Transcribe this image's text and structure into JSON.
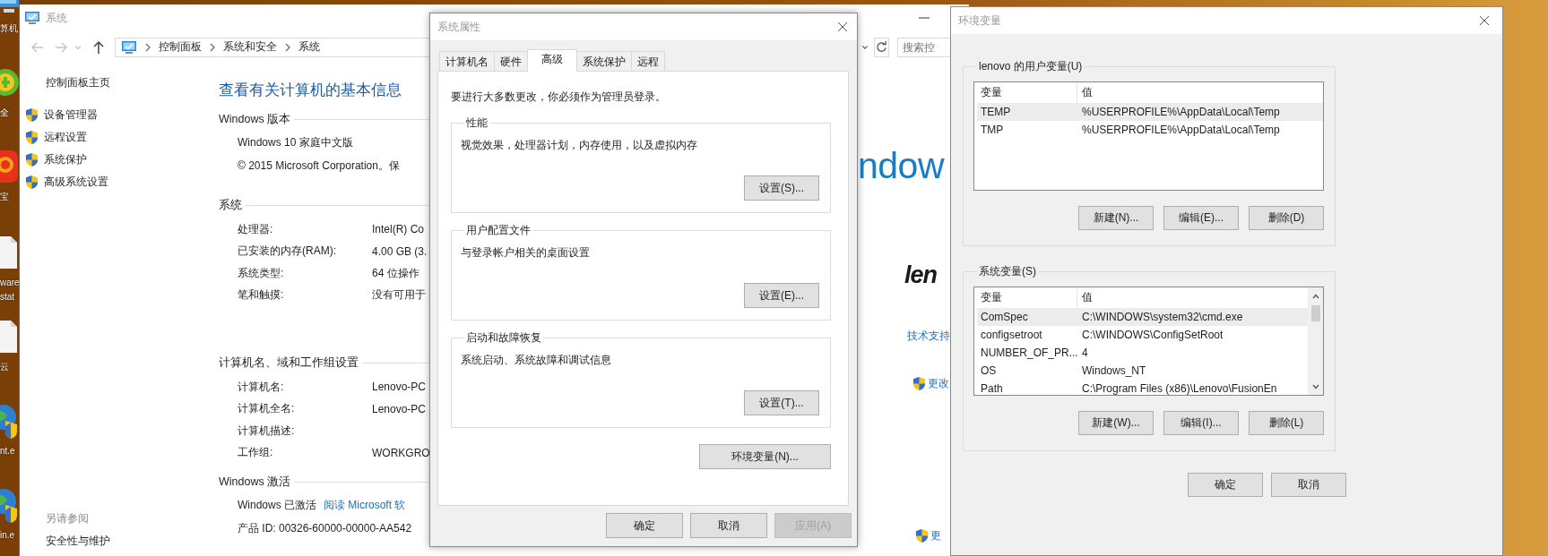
{
  "desktop": {
    "icons": [
      {
        "kind": "monitor",
        "lines": [
          "算机"
        ]
      },
      {
        "kind": "ring",
        "lines": [
          "全"
        ]
      },
      {
        "kind": "badge",
        "lines": [
          "宝"
        ]
      },
      {
        "kind": "file",
        "lines": [
          "ware",
          "stat"
        ]
      },
      {
        "kind": "file",
        "lines": [
          "云"
        ]
      },
      {
        "kind": "globe",
        "lines": [
          "nt.e"
        ]
      },
      {
        "kind": "globe",
        "lines": [
          "in.e"
        ]
      }
    ]
  },
  "system_window": {
    "title": "系统",
    "breadcrumb": [
      "控制面板",
      "系统和安全",
      "系统"
    ],
    "search": {
      "placeholder": "搜索控"
    },
    "sidebar": {
      "home": "控制面板主页",
      "items": [
        "设备管理器",
        "远程设置",
        "系统保护",
        "高级系统设置"
      ],
      "see_also_title": "另请参阅",
      "see_also_items": [
        "安全性与维护"
      ]
    },
    "heading": "查看有关计算机的基本信息",
    "sections": [
      {
        "title": "Windows 版本",
        "lines": [
          "Windows 10 家庭中文版",
          "© 2015 Microsoft Corporation。保"
        ]
      },
      {
        "title": "系统",
        "rows": [
          {
            "label": "处理器:",
            "value": "Intel(R) Co"
          },
          {
            "label": "已安装的内存(RAM):",
            "value": "4.00 GB (3."
          },
          {
            "label": "系统类型:",
            "value": "64 位操作"
          },
          {
            "label": "笔和触摸:",
            "value": "没有可用于"
          }
        ]
      },
      {
        "title": "计算机名、域和工作组设置",
        "rows": [
          {
            "label": "计算机名:",
            "value": "Lenovo-PC"
          },
          {
            "label": "计算机全名:",
            "value": "Lenovo-PC"
          },
          {
            "label": "计算机描述:"
          },
          {
            "label": "工作组:",
            "value": "WORKGRO"
          }
        ]
      },
      {
        "title": "Windows 激活",
        "activation": {
          "status": "Windows 已激活",
          "link": "阅读 Microsoft 软"
        },
        "lines": [
          "产品 ID: 00326-60000-00000-AA542"
        ]
      }
    ],
    "brand": {
      "windows_text": "ndow",
      "oem_logo": "len",
      "support_link": "技术支持",
      "change_links": [
        "更改",
        "更"
      ]
    }
  },
  "system_properties": {
    "title": "系统属性",
    "tabs": [
      {
        "label": "计算机名",
        "selected": false
      },
      {
        "label": "硬件",
        "selected": false
      },
      {
        "label": "高级",
        "selected": true
      },
      {
        "label": "系统保护",
        "selected": false
      },
      {
        "label": "远程",
        "selected": false
      }
    ],
    "notice": "要进行大多数更改，你必须作为管理员登录。",
    "groups": [
      {
        "title": "性能",
        "description": "视觉效果，处理器计划，内存使用，以及虚拟内存",
        "button": "设置(S)..."
      },
      {
        "title": "用户配置文件",
        "description": "与登录帐户相关的桌面设置",
        "button": "设置(E)..."
      },
      {
        "title": "启动和故障恢复",
        "description": "系统启动、系统故障和调试信息",
        "button": "设置(T)..."
      }
    ],
    "env_button": "环境变量(N)...",
    "buttons": [
      {
        "label": "确定",
        "disabled": false
      },
      {
        "label": "取消",
        "disabled": false
      },
      {
        "label": "应用(A)",
        "disabled": true
      }
    ]
  },
  "environment_variables": {
    "title": "环境变量",
    "lists": [
      {
        "title": "lenovo 的用户变量(U)",
        "columns": [
          "变量",
          "值"
        ],
        "rows": [
          {
            "name": "TEMP",
            "value": "%USERPROFILE%\\AppData\\Local\\Temp",
            "selected": true
          },
          {
            "name": "TMP",
            "value": "%USERPROFILE%\\AppData\\Local\\Temp",
            "selected": false
          }
        ],
        "buttons": [
          "新建(N)...",
          "编辑(E)...",
          "删除(D)"
        ]
      },
      {
        "title": "系统变量(S)",
        "columns": [
          "变量",
          "值"
        ],
        "rows": [
          {
            "name": "ComSpec",
            "value": "C:\\WINDOWS\\system32\\cmd.exe",
            "selected": true
          },
          {
            "name": "configsetroot",
            "value": "C:\\WINDOWS\\ConfigSetRoot",
            "selected": false
          },
          {
            "name": "NUMBER_OF_PR...",
            "value": "4",
            "selected": false
          },
          {
            "name": "OS",
            "value": "Windows_NT",
            "selected": false
          },
          {
            "name": "Path",
            "value": "C:\\Program Files (x86)\\Lenovo\\FusionEn",
            "selected": false
          }
        ],
        "buttons": [
          "新建(W)...",
          "编辑(I)...",
          "删除(L)"
        ]
      }
    ],
    "buttons": [
      "确定",
      "取消"
    ]
  }
}
